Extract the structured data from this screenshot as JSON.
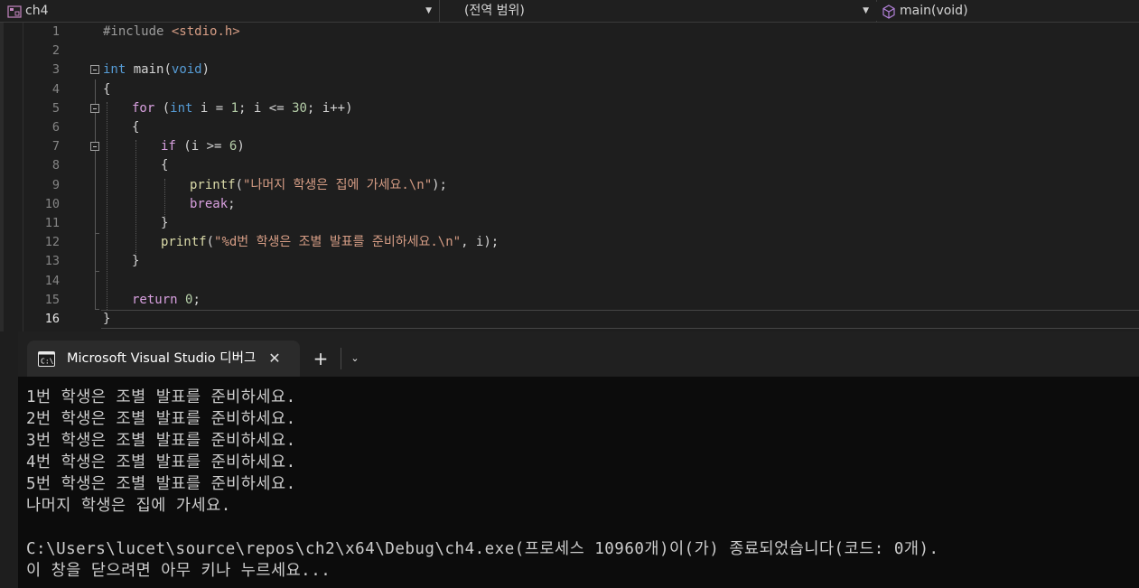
{
  "navigation_bar": {
    "project": "ch4",
    "scope": "(전역 범위)",
    "function": "main(void)"
  },
  "editor": {
    "current_line": 16,
    "lines": [
      {
        "n": "1"
      },
      {
        "n": "2"
      },
      {
        "n": "3"
      },
      {
        "n": "4"
      },
      {
        "n": "5"
      },
      {
        "n": "6"
      },
      {
        "n": "7"
      },
      {
        "n": "8"
      },
      {
        "n": "9"
      },
      {
        "n": "10"
      },
      {
        "n": "11"
      },
      {
        "n": "12"
      },
      {
        "n": "13"
      },
      {
        "n": "14"
      },
      {
        "n": "15"
      },
      {
        "n": "16"
      }
    ],
    "code": {
      "l1_include": "#include",
      "l1_header": "<stdio.h>",
      "l3_kw": "int",
      "l3_name": "main",
      "l3_param": "void",
      "l4": "{",
      "l5_for": "for",
      "l5_int": "int",
      "l5_rest1": " i = ",
      "l5_n1": "1",
      "l5_rest2": "; i <= ",
      "l5_n2": "30",
      "l5_rest3": "; i++)",
      "l6": "{",
      "l7_if": "if",
      "l7_rest": " (i >= ",
      "l7_n": "6",
      "l8": "{",
      "l9_fn": "printf",
      "l9_str": "\"나머지 학생은 집에 가세요.\\n\"",
      "l10": "break",
      "l11": "}",
      "l12_fn": "printf",
      "l12_str": "\"%d번 학생은 조별 발표를 준비하세요.\\n\"",
      "l12_rest": ", i);",
      "l13": "}",
      "l15_ret": "return",
      "l15_n": "0",
      "l16": "}"
    }
  },
  "terminal": {
    "tab_title": "Microsoft Visual Studio 디버그",
    "output": [
      "1번 학생은 조별 발표를 준비하세요.",
      "2번 학생은 조별 발표를 준비하세요.",
      "3번 학생은 조별 발표를 준비하세요.",
      "4번 학생은 조별 발표를 준비하세요.",
      "5번 학생은 조별 발표를 준비하세요.",
      "나머지 학생은 집에 가세요.",
      "",
      "C:\\Users\\lucet\\source\\repos\\ch2\\x64\\Debug\\ch4.exe(프로세스 10960개)이(가) 종료되었습니다(코드: 0개).",
      "이 창을 닫으려면 아무 키나 누르세요..."
    ]
  }
}
